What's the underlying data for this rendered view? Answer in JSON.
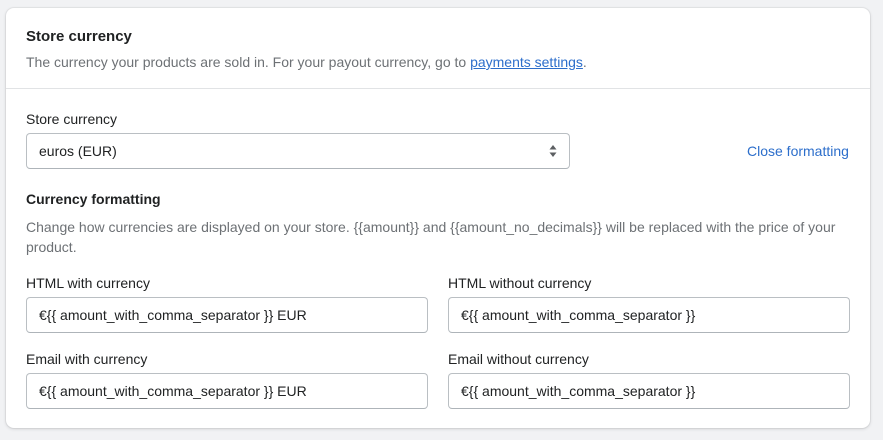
{
  "header": {
    "title": "Store currency",
    "description_prefix": "The currency your products are sold in. For your payout currency, go to ",
    "description_link": "payments settings",
    "description_suffix": "."
  },
  "store_currency": {
    "label": "Store currency",
    "selected": "euros (EUR)",
    "close_formatting": "Close formatting",
    "select_icon": "chevron-up-down-icon"
  },
  "formatting": {
    "title": "Currency formatting",
    "description": "Change how currencies are displayed on your store. {{amount}} and {{amount_no_decimals}} will be replaced with the price of your product.",
    "fields": [
      {
        "label": "HTML with currency",
        "value": "€{{ amount_with_comma_separator }} EUR"
      },
      {
        "label": "HTML without currency",
        "value": "€{{ amount_with_comma_separator }}"
      },
      {
        "label": "Email with currency",
        "value": "€{{ amount_with_comma_separator }} EUR"
      },
      {
        "label": "Email without currency",
        "value": "€{{ amount_with_comma_separator }}"
      }
    ]
  },
  "colors": {
    "link": "#2c6ecb",
    "text": "#202223",
    "subdued": "#6d7175",
    "border": "#babfc3"
  }
}
